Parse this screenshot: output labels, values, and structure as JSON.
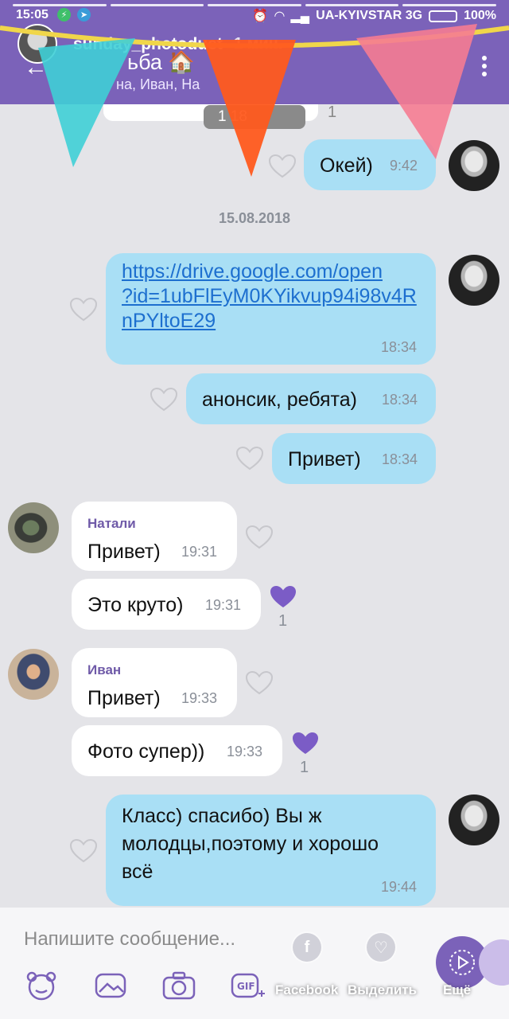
{
  "status_bar": {
    "time": "15:05",
    "carrier": "UA-KYIVSTAR 3G",
    "battery": "100%"
  },
  "story": {
    "username": "sunday_photoduet",
    "time_ago": "1 мин.",
    "actions": [
      {
        "label": "Facebook",
        "icon": "facebook-icon"
      },
      {
        "label": "Выделить",
        "icon": "highlight-heart-icon"
      },
      {
        "label": "Ещё",
        "icon": "more-icon"
      }
    ]
  },
  "chat": {
    "title": "ьба 🏠",
    "subtitle": "на, Иван, На",
    "peek_badge": "1       18",
    "peek_count": "1"
  },
  "messages": {
    "m1": {
      "text": "Окей)",
      "time": "9:42"
    },
    "date": "15.08.2018",
    "m2": {
      "text": "https://drive.google.com/open?id=1ubFlEyM0KYikvup94i98v4RnPYltoE29",
      "lines": [
        "https://drive.google.com/open",
        "?id=1ubFlEyM0KYikvup94i98v4R",
        "nPYltoE29"
      ],
      "time": "18:34"
    },
    "m3": {
      "text": "анонсик, ребята)",
      "time": "18:34"
    },
    "m4": {
      "text": "Привет)",
      "time": "18:34"
    },
    "m5": {
      "sender": "Натали",
      "text": "Привет)",
      "time": "19:31"
    },
    "m6": {
      "text": "Это круто)",
      "time": "19:31",
      "likes": "1"
    },
    "m7": {
      "sender": "Иван",
      "text": "Привет)",
      "time": "19:33"
    },
    "m8": {
      "text": "Фото супер))",
      "time": "19:33",
      "likes": "1"
    },
    "m9": {
      "lines": [
        "Класс) спасибо) Вы ж",
        "молодцы,поэтому и хорошо",
        "всё"
      ],
      "time": "19:44"
    }
  },
  "composer": {
    "placeholder": "Напишите сообщение..."
  },
  "colors": {
    "header": "#7b62b9",
    "outgoing_bubble": "#a9dff5",
    "incoming_bubble": "#ffffff",
    "like_filled": "#7b5cc6",
    "link": "#1d6fcf"
  }
}
